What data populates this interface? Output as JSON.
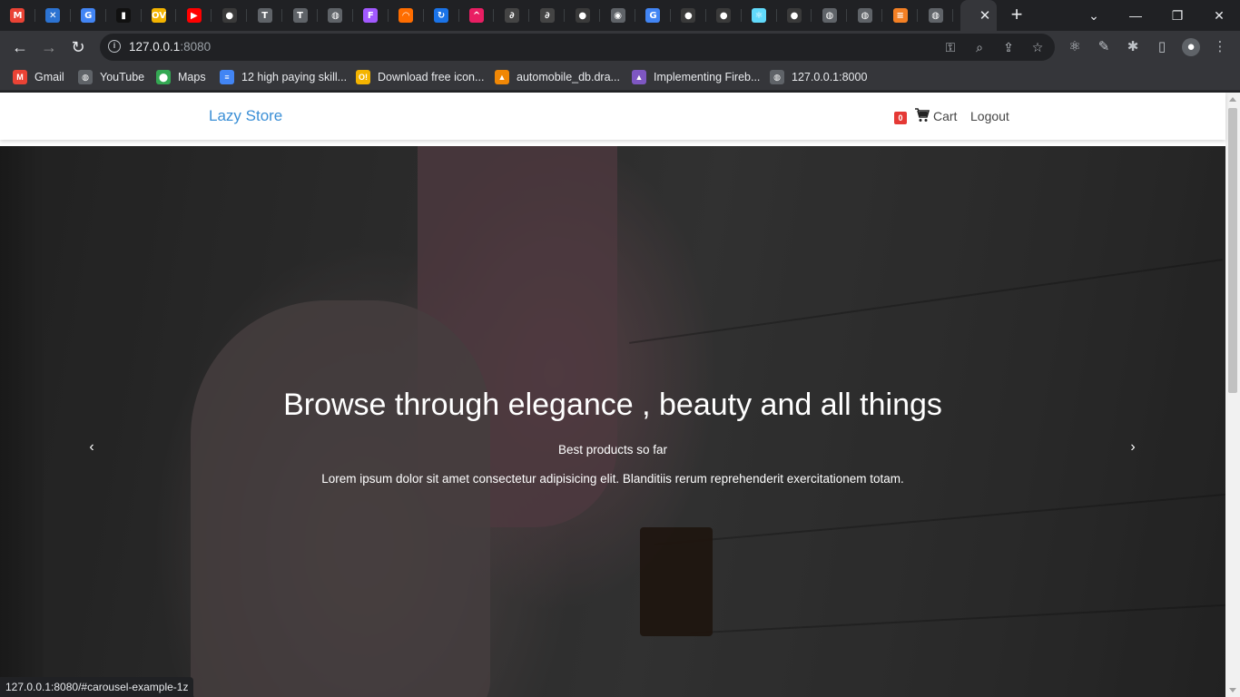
{
  "browser": {
    "tabs": [
      {
        "icon": "gmail-icon",
        "glyph": "M",
        "color": "#ea4335"
      },
      {
        "icon": "figma-alt-icon",
        "glyph": "✕",
        "color": "#2c73d2"
      },
      {
        "icon": "google-icon",
        "glyph": "G",
        "color": "#4285f4"
      },
      {
        "icon": "dark-app-icon",
        "glyph": "▮",
        "color": "#111111"
      },
      {
        "icon": "ov-icon",
        "glyph": "OV",
        "color": "#f4b400"
      },
      {
        "icon": "youtube-icon",
        "glyph": "▶",
        "color": "#ff0000"
      },
      {
        "icon": "github-icon",
        "glyph": "●",
        "color": "#3a3a3a"
      },
      {
        "icon": "t-icon",
        "glyph": "T",
        "color": "#5f6368"
      },
      {
        "icon": "t-icon",
        "glyph": "T",
        "color": "#5f6368"
      },
      {
        "icon": "globe-icon",
        "glyph": "◍",
        "color": "#5f6368"
      },
      {
        "icon": "figma-icon",
        "glyph": "F",
        "color": "#a259ff"
      },
      {
        "icon": "arc-icon",
        "glyph": "◠",
        "color": "#ff6d00"
      },
      {
        "icon": "refresh-app-icon",
        "glyph": "↻",
        "color": "#1a73e8"
      },
      {
        "icon": "chevron-app-icon",
        "glyph": "^",
        "color": "#e91e63"
      },
      {
        "icon": "curl-icon",
        "glyph": "∂",
        "color": "#444444"
      },
      {
        "icon": "curl-icon",
        "glyph": "∂",
        "color": "#444444"
      },
      {
        "icon": "github-icon",
        "glyph": "●",
        "color": "#3a3a3a"
      },
      {
        "icon": "eye-icon",
        "glyph": "◉",
        "color": "#5f6368"
      },
      {
        "icon": "google-icon",
        "glyph": "G",
        "color": "#4285f4"
      },
      {
        "icon": "github-icon",
        "glyph": "●",
        "color": "#3a3a3a"
      },
      {
        "icon": "github-icon",
        "glyph": "●",
        "color": "#3a3a3a"
      },
      {
        "icon": "react-icon",
        "glyph": "⚛",
        "color": "#61dafb"
      },
      {
        "icon": "github-icon",
        "glyph": "●",
        "color": "#3a3a3a"
      },
      {
        "icon": "globe-icon",
        "glyph": "◍",
        "color": "#5f6368"
      },
      {
        "icon": "globe-icon",
        "glyph": "◍",
        "color": "#5f6368"
      },
      {
        "icon": "stackoverflow-icon",
        "glyph": "≡",
        "color": "#f48024"
      },
      {
        "icon": "globe-icon",
        "glyph": "◍",
        "color": "#5f6368"
      }
    ],
    "active_tab_close": "✕",
    "new_tab": "+",
    "url_host": "127.0.0.1",
    "url_port": ":8080",
    "bookmarks": [
      {
        "label": "Gmail",
        "icon": "gmail-icon",
        "glyph": "M",
        "color": "#ea4335"
      },
      {
        "label": "YouTube",
        "icon": "globe-icon",
        "glyph": "◍",
        "color": "#5f6368"
      },
      {
        "label": "Maps",
        "icon": "maps-icon",
        "glyph": "⬤",
        "color": "#34a853"
      },
      {
        "label": "12 high paying skill...",
        "icon": "docs-icon",
        "glyph": "≡",
        "color": "#4285f4"
      },
      {
        "label": "Download free icon...",
        "icon": "icons8-icon",
        "glyph": "O!",
        "color": "#f4b400"
      },
      {
        "label": "automobile_db.dra...",
        "icon": "drawio-icon",
        "glyph": "▲",
        "color": "#f08705"
      },
      {
        "label": "Implementing Fireb...",
        "icon": "firebase-icon",
        "glyph": "▲",
        "color": "#7e57c2"
      },
      {
        "label": "127.0.0.1:8000",
        "icon": "globe-icon",
        "glyph": "◍",
        "color": "#5f6368"
      }
    ],
    "status_url": "127.0.0.1:8080/#carousel-example-1z"
  },
  "site": {
    "brand": "Lazy Store",
    "cart_count": "0",
    "cart_label": "Cart",
    "logout_label": "Logout",
    "hero": {
      "title": "Browse through elegance , beauty and all things",
      "subtitle": "Best products so far",
      "text": "Lorem ipsum dolor sit amet consectetur adipisicing elit. Blanditiis rerum reprehenderit exercitationem totam.",
      "prev_glyph": "‹",
      "next_glyph": "›"
    }
  },
  "colors": {
    "brand": "#3b8fd6",
    "badge": "#e53935"
  }
}
